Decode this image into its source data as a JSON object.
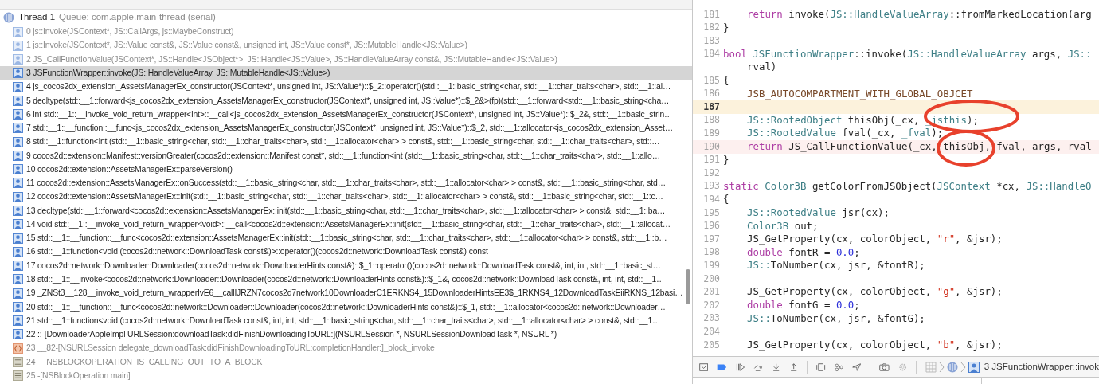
{
  "call_stack": {
    "thread": {
      "name": "Thread 1",
      "queue": "Queue: com.apple.main-thread (serial)"
    },
    "frames": [
      {
        "label": "0 js::Invoke(JSContext*, JS::CallArgs, js::MaybeConstruct)",
        "kind": "user",
        "dimmed": true,
        "selected": false
      },
      {
        "label": "1 js::Invoke(JSContext*, JS::Value const&, JS::Value const&, unsigned int, JS::Value const*, JS::MutableHandle<JS::Value>)",
        "kind": "user",
        "dimmed": true,
        "selected": false
      },
      {
        "label": "2 JS_CallFunctionValue(JSContext*, JS::Handle<JSObject*>, JS::Handle<JS::Value>, JS::HandleValueArray const&, JS::MutableHandle<JS::Value>)",
        "kind": "user",
        "dimmed": true,
        "selected": false
      },
      {
        "label": "3 JSFunctionWrapper::invoke(JS::HandleValueArray, JS::MutableHandle<JS::Value>)",
        "kind": "user",
        "dimmed": false,
        "selected": true
      },
      {
        "label": "4 js_cocos2dx_extension_AssetsManagerEx_constructor(JSContext*, unsigned int, JS::Value*)::$_2::operator()(std::__1::basic_string<char, std::__1::char_traits<char>, std::__1::al…",
        "kind": "user",
        "dimmed": false,
        "selected": false
      },
      {
        "label": "5 decltype(std::__1::forward<js_cocos2dx_extension_AssetsManagerEx_constructor(JSContext*, unsigned int, JS::Value*)::$_2&>(fp)(std::__1::forward<std::__1::basic_string<cha…",
        "kind": "user",
        "dimmed": false,
        "selected": false
      },
      {
        "label": "6 int std::__1::__invoke_void_return_wrapper<int>::__call<js_cocos2dx_extension_AssetsManagerEx_constructor(JSContext*, unsigned int, JS::Value*)::$_2&, std::__1::basic_strin…",
        "kind": "user",
        "dimmed": false,
        "selected": false
      },
      {
        "label": "7 std::__1::__function::__func<js_cocos2dx_extension_AssetsManagerEx_constructor(JSContext*, unsigned int, JS::Value*)::$_2, std::__1::allocator<js_cocos2dx_extension_Asset…",
        "kind": "user",
        "dimmed": false,
        "selected": false
      },
      {
        "label": "8 std::__1::function<int (std::__1::basic_string<char, std::__1::char_traits<char>, std::__1::allocator<char> > const&, std::__1::basic_string<char, std::__1::char_traits<char>, std::…",
        "kind": "user",
        "dimmed": false,
        "selected": false
      },
      {
        "label": "9 cocos2d::extension::Manifest::versionGreater(cocos2d::extension::Manifest const*, std::__1::function<int (std::__1::basic_string<char, std::__1::char_traits<char>, std::__1::allo…",
        "kind": "user",
        "dimmed": false,
        "selected": false
      },
      {
        "label": "10 cocos2d::extension::AssetsManagerEx::parseVersion()",
        "kind": "user",
        "dimmed": false,
        "selected": false
      },
      {
        "label": "11 cocos2d::extension::AssetsManagerEx::onSuccess(std::__1::basic_string<char, std::__1::char_traits<char>, std::__1::allocator<char> > const&, std::__1::basic_string<char, std…",
        "kind": "user",
        "dimmed": false,
        "selected": false
      },
      {
        "label": "12 cocos2d::extension::AssetsManagerEx::init(std::__1::basic_string<char, std::__1::char_traits<char>, std::__1::allocator<char> > const&, std::__1::basic_string<char, std::__1::c…",
        "kind": "user",
        "dimmed": false,
        "selected": false
      },
      {
        "label": "13 decltype(std::__1::forward<cocos2d::extension::AssetsManagerEx::init(std::__1::basic_string<char, std::__1::char_traits<char>, std::__1::allocator<char> > const&, std::__1::ba…",
        "kind": "user",
        "dimmed": false,
        "selected": false
      },
      {
        "label": "14 void std::__1::__invoke_void_return_wrapper<void>::__call<cocos2d::extension::AssetsManagerEx::init(std::__1::basic_string<char, std::__1::char_traits<char>, std::__1::allocat…",
        "kind": "user",
        "dimmed": false,
        "selected": false
      },
      {
        "label": "15 std::__1::__function::__func<cocos2d::extension::AssetsManagerEx::init(std::__1::basic_string<char, std::__1::char_traits<char>, std::__1::allocator<char> > const&, std::__1::b…",
        "kind": "user",
        "dimmed": false,
        "selected": false
      },
      {
        "label": "16 std::__1::function<void (cocos2d::network::DownloadTask const&)>::operator()(cocos2d::network::DownloadTask const&) const",
        "kind": "user",
        "dimmed": false,
        "selected": false
      },
      {
        "label": "17 cocos2d::network::Downloader::Downloader(cocos2d::network::DownloaderHints const&)::$_1::operator()(cocos2d::network::DownloadTask const&, int, int, std::__1::basic_st…",
        "kind": "user",
        "dimmed": false,
        "selected": false
      },
      {
        "label": "18 std::__1::__invoke<cocos2d::network::Downloader::Downloader(cocos2d::network::DownloaderHints const&)::$_1&, cocos2d::network::DownloadTask const&, int, int, std::__1…",
        "kind": "user",
        "dimmed": false,
        "selected": false
      },
      {
        "label": "19 _ZNSt3__128__invoke_void_return_wrapperIvE6__callIJRZN7cocos2d7network10DownloaderC1ERKNS4_15DownloaderHintsEE3$_1RKNS4_12DownloadTaskEiiRKNS_12basi…",
        "kind": "user",
        "dimmed": false,
        "selected": false
      },
      {
        "label": "20 std::__1::__function::__func<cocos2d::network::Downloader::Downloader(cocos2d::network::DownloaderHints const&)::$_1, std::__1::allocator<cocos2d::network::Downloader…",
        "kind": "user",
        "dimmed": false,
        "selected": false
      },
      {
        "label": "21 std::__1::function<void (cocos2d::network::DownloadTask const&, int, int, std::__1::basic_string<char, std::__1::char_traits<char>, std::__1::allocator<char> > const&, std::__1…",
        "kind": "user",
        "dimmed": false,
        "selected": false
      },
      {
        "label": "22 ::-[DownloaderAppleImpl URLSession:downloadTask:didFinishDownloadingToURL:](NSURLSession *, NSURLSessionDownloadTask *, NSURL *)",
        "kind": "user",
        "dimmed": false,
        "selected": false
      },
      {
        "label": "23 __82-[NSURLSession delegate_downloadTask:didFinishDownloadingToURL:completionHandler:]_block_invoke",
        "kind": "block",
        "dimmed": true,
        "selected": false
      },
      {
        "label": "24 __NSBLOCKOPERATION_IS_CALLING_OUT_TO_A_BLOCK__",
        "kind": "system",
        "dimmed": true,
        "selected": false
      },
      {
        "label": "25 -[NSBlockOperation main]",
        "kind": "system",
        "dimmed": true,
        "selected": false
      }
    ]
  },
  "editor": {
    "lines": [
      {
        "number": "181",
        "indented": true,
        "tokens": [
          {
            "kind": "keyword",
            "text": "return"
          },
          {
            "kind": "plain",
            "text": " invoke("
          },
          {
            "kind": "type",
            "text": "JS::HandleValueArray"
          },
          {
            "kind": "plain",
            "text": "::fromMarkedLocation(arg"
          }
        ]
      },
      {
        "number": "182",
        "tokens": [
          {
            "kind": "plain",
            "text": "}"
          }
        ]
      },
      {
        "number": "183"
      },
      {
        "number": "184",
        "tokens": [
          {
            "kind": "keyword",
            "text": "bool"
          },
          {
            "kind": "type",
            "text": " JSFunctionWrapper"
          },
          {
            "kind": "plain",
            "text": "::invoke("
          },
          {
            "kind": "type",
            "text": "JS::HandleValueArray"
          },
          {
            "kind": "plain",
            "text": " args, "
          },
          {
            "kind": "type",
            "text": "JS::"
          }
        ]
      },
      {
        "indented": true,
        "tokens": [
          {
            "kind": "plain",
            "text": "rval)"
          }
        ]
      },
      {
        "number": "185",
        "tokens": [
          {
            "kind": "plain",
            "text": "{"
          }
        ]
      },
      {
        "number": "186",
        "indented": true,
        "tokens": [
          {
            "kind": "macro",
            "text": "JSB_AUTOCOMPARTMENT_WITH_GLOBAL_OBJCET"
          }
        ]
      },
      {
        "number": "187",
        "current_line": true
      },
      {
        "number": "188",
        "indented": true,
        "tokens": [
          {
            "kind": "type",
            "text": "JS::RootedObject"
          },
          {
            "kind": "plain",
            "text": " thisObj(_cx, "
          },
          {
            "kind": "type",
            "text": "_jsthis"
          },
          {
            "kind": "plain",
            "text": ");"
          }
        ]
      },
      {
        "number": "189",
        "indented": true,
        "tokens": [
          {
            "kind": "type",
            "text": "JS::RootedValue"
          },
          {
            "kind": "plain",
            "text": " fval(_cx, "
          },
          {
            "kind": "type",
            "text": "_fval"
          },
          {
            "kind": "plain",
            "text": ");"
          }
        ]
      },
      {
        "number": "190",
        "indented": true,
        "error_line": true,
        "tokens": [
          {
            "kind": "keyword",
            "text": "return"
          },
          {
            "kind": "plain",
            "text": " JS_CallFunctionValue(_cx, thisObj, fval, args, rval"
          }
        ]
      },
      {
        "number": "191",
        "tokens": [
          {
            "kind": "plain",
            "text": "}"
          }
        ]
      },
      {
        "number": "192"
      },
      {
        "number": "193",
        "tokens": [
          {
            "kind": "keyword",
            "text": "static"
          },
          {
            "kind": "type",
            "text": " Color3B"
          },
          {
            "kind": "plain",
            "text": " getColorFromJSObject("
          },
          {
            "kind": "type",
            "text": "JSContext"
          },
          {
            "kind": "plain",
            "text": " *cx, "
          },
          {
            "kind": "type",
            "text": "JS::HandleO"
          }
        ]
      },
      {
        "number": "194",
        "tokens": [
          {
            "kind": "plain",
            "text": "{"
          }
        ]
      },
      {
        "number": "195",
        "indented": true,
        "tokens": [
          {
            "kind": "type",
            "text": "JS::RootedValue"
          },
          {
            "kind": "plain",
            "text": " jsr(cx);"
          }
        ]
      },
      {
        "number": "196",
        "indented": true,
        "tokens": [
          {
            "kind": "type",
            "text": "Color3B"
          },
          {
            "kind": "plain",
            "text": " out;"
          }
        ]
      },
      {
        "number": "197",
        "indented": true,
        "tokens": [
          {
            "kind": "plain",
            "text": "JS_GetProperty(cx, colorObject, "
          },
          {
            "kind": "string",
            "text": "\"r\""
          },
          {
            "kind": "plain",
            "text": ", &jsr);"
          }
        ]
      },
      {
        "number": "198",
        "indented": true,
        "tokens": [
          {
            "kind": "keyword",
            "text": "double"
          },
          {
            "kind": "plain",
            "text": " fontR = "
          },
          {
            "kind": "number",
            "text": "0.0"
          },
          {
            "kind": "plain",
            "text": ";"
          }
        ]
      },
      {
        "number": "199",
        "indented": true,
        "tokens": [
          {
            "kind": "type",
            "text": "JS::"
          },
          {
            "kind": "plain",
            "text": "ToNumber(cx, jsr, &fontR);"
          }
        ]
      },
      {
        "number": "200"
      },
      {
        "number": "201",
        "indented": true,
        "tokens": [
          {
            "kind": "plain",
            "text": "JS_GetProperty(cx, colorObject, "
          },
          {
            "kind": "string",
            "text": "\"g\""
          },
          {
            "kind": "plain",
            "text": ", &jsr);"
          }
        ]
      },
      {
        "number": "202",
        "indented": true,
        "tokens": [
          {
            "kind": "keyword",
            "text": "double"
          },
          {
            "kind": "plain",
            "text": " fontG = "
          },
          {
            "kind": "number",
            "text": "0.0"
          },
          {
            "kind": "plain",
            "text": ";"
          }
        ]
      },
      {
        "number": "203",
        "indented": true,
        "tokens": [
          {
            "kind": "type",
            "text": "JS::"
          },
          {
            "kind": "plain",
            "text": "ToNumber(cx, jsr, &fontG);"
          }
        ]
      },
      {
        "number": "204"
      },
      {
        "number": "205",
        "indented": true,
        "tokens": [
          {
            "kind": "plain",
            "text": "JS_GetProperty(cx, colorObject, "
          },
          {
            "kind": "string",
            "text": "\"b\""
          },
          {
            "kind": "plain",
            "text": ", &jsr);"
          }
        ]
      }
    ]
  },
  "debug_bar": {
    "breadcrumb": "3 JSFunctionWrapper::invok"
  }
}
